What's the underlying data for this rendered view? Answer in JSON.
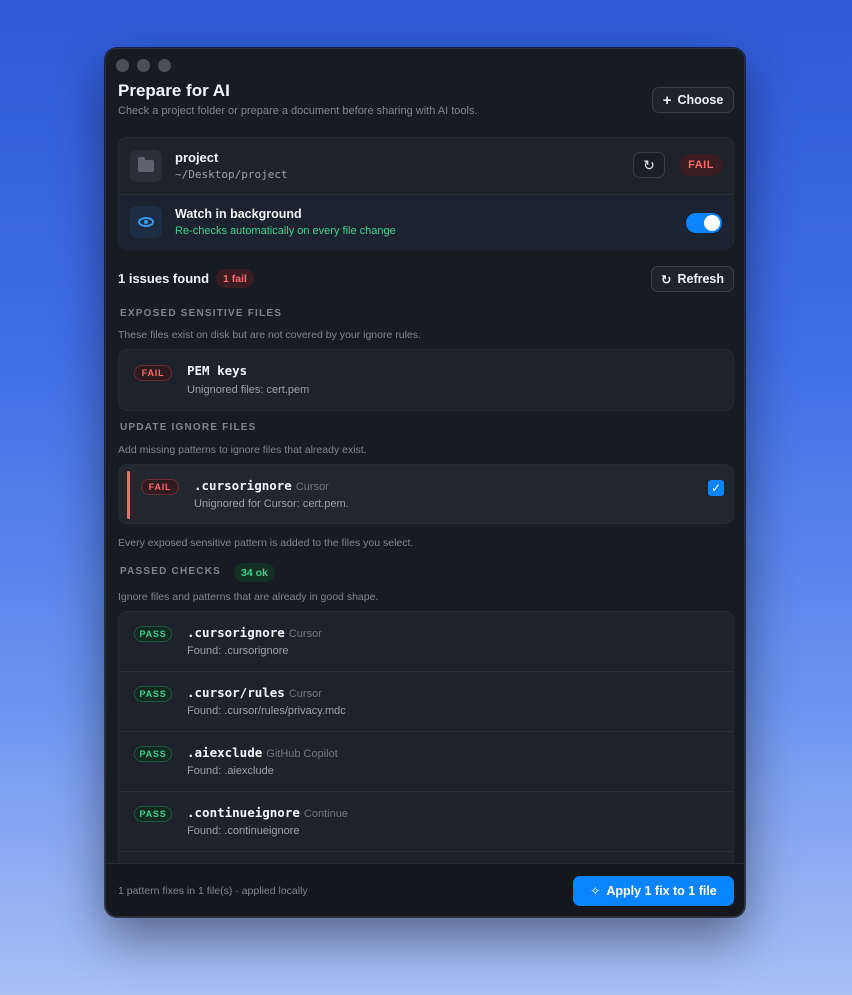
{
  "window": {
    "title": "Prepare for AI",
    "subtitle": "Check a project folder or prepare a document before sharing with AI tools.",
    "choose_label": "Choose"
  },
  "project": {
    "name": "project",
    "path": "~/Desktop/project",
    "status": "FAIL"
  },
  "watch": {
    "title": "Watch in background",
    "subtitle": "Re-checks automatically on every file change",
    "enabled": true
  },
  "issues": {
    "title": "1 issues found",
    "fail_count": "1 fail",
    "refresh_label": "Refresh"
  },
  "sections": {
    "exposed": {
      "heading": "EXPOSED SENSITIVE FILES",
      "desc": "These files exist on disk but are not covered by your ignore rules.",
      "items": [
        {
          "tag": "FAIL",
          "name": "PEM keys",
          "detail": "Unignored files: cert.pem"
        }
      ]
    },
    "update": {
      "heading": "UPDATE IGNORE FILES",
      "desc": "Add missing patterns to ignore files that already exist.",
      "items": [
        {
          "tag": "FAIL",
          "name": ".cursorignore",
          "tool": "Cursor",
          "detail": "Unignored for Cursor: cert.pem.",
          "checked": true
        }
      ],
      "footnote": "Every exposed sensitive pattern is added to the files you select."
    },
    "passed": {
      "heading": "PASSED CHECKS",
      "count": "34 ok",
      "desc": "Ignore files and patterns that are already in good shape.",
      "items": [
        {
          "tag": "PASS",
          "name": ".cursorignore",
          "tool": "Cursor",
          "detail": "Found: .cursorignore"
        },
        {
          "tag": "PASS",
          "name": ".cursor/rules",
          "tool": "Cursor",
          "detail": "Found: .cursor/rules/privacy.mdc"
        },
        {
          "tag": "PASS",
          "name": ".aiexclude",
          "tool": "GitHub Copilot",
          "detail": "Found: .aiexclude"
        },
        {
          "tag": "PASS",
          "name": ".continueignore",
          "tool": "Continue",
          "detail": "Found: .continueignore"
        }
      ]
    }
  },
  "footer": {
    "summary": "1 pattern fixes in 1 file(s) · applied locally",
    "apply_label": "Apply 1 fix to 1 file"
  },
  "colors": {
    "accent": "#0a84ff",
    "fail": "#ff6b6b",
    "pass": "#3fcf8e",
    "window_bg": "#171b22"
  }
}
